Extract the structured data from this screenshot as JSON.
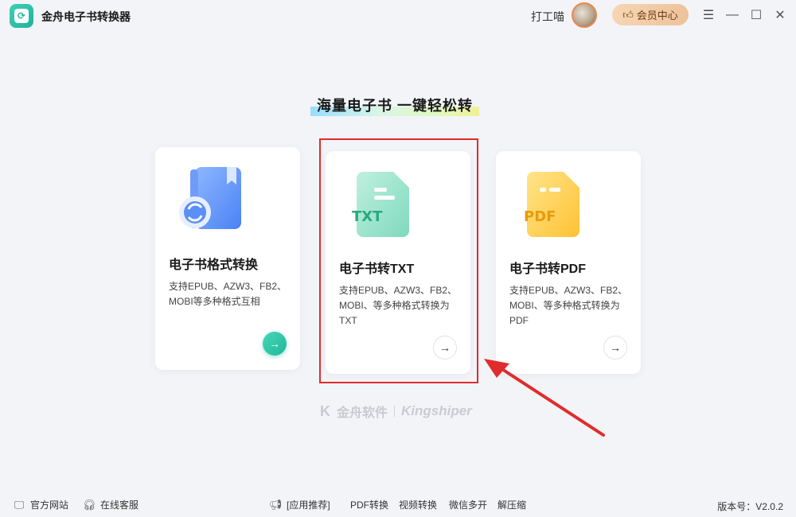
{
  "app": {
    "title": "金舟电子书转换器"
  },
  "header": {
    "user_name": "打工喵",
    "vip_label": "会员中心"
  },
  "slogan": "海量电子书  一键轻松转",
  "cards": [
    {
      "title": "电子书格式转换",
      "desc": "支持EPUB、AZW3、FB2、MOBI等多种格式互相",
      "icon": "book-convert-icon"
    },
    {
      "title": "电子书转TXT",
      "desc": "支持EPUB、AZW3、FB2、MOBI、等多种格式转换为TXT",
      "icon": "txt-file-icon",
      "icon_text": "TXT"
    },
    {
      "title": "电子书转PDF",
      "desc": "支持EPUB、AZW3、FB2、MOBI、等多种格式转换为PDF",
      "icon": "pdf-file-icon",
      "icon_text": "PDF"
    }
  ],
  "brand": {
    "cn": "金舟软件",
    "en": "Kingshiper"
  },
  "footer": {
    "official_site": "官方网站",
    "online_service": "在线客服",
    "recommend": "[应用推荐]",
    "links": [
      "PDF转换",
      "视频转换",
      "微信多开",
      "解压缩"
    ],
    "version": "版本号：V2.0.2"
  },
  "colors": {
    "accent": "#20b899",
    "vip": "#eec29a",
    "highlight": "#e02c2c"
  }
}
